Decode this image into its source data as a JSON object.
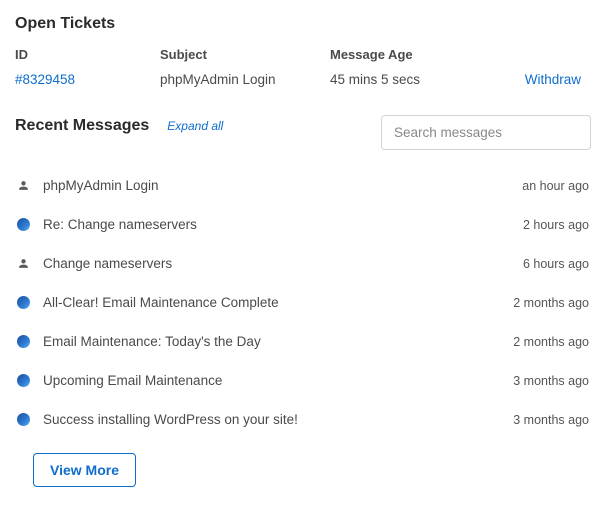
{
  "open_tickets": {
    "title": "Open Tickets",
    "headers": {
      "id": "ID",
      "subject": "Subject",
      "age": "Message Age"
    },
    "rows": [
      {
        "id": "#8329458",
        "subject": "phpMyAdmin Login",
        "age": "45 mins 5 secs",
        "action": "Withdraw"
      }
    ]
  },
  "recent": {
    "title": "Recent Messages",
    "expand": "Expand all",
    "search_placeholder": "Search messages",
    "view_more": "View More",
    "messages": [
      {
        "icon": "person",
        "subject": "phpMyAdmin Login",
        "age": "an hour ago"
      },
      {
        "icon": "globe",
        "subject": "Re: Change nameservers",
        "age": "2 hours ago"
      },
      {
        "icon": "person",
        "subject": "Change nameservers",
        "age": "6 hours ago"
      },
      {
        "icon": "globe",
        "subject": "All-Clear! Email Maintenance Complete",
        "age": "2 months ago"
      },
      {
        "icon": "globe",
        "subject": "Email Maintenance: Today's the Day",
        "age": "2 months ago"
      },
      {
        "icon": "globe",
        "subject": "Upcoming Email Maintenance",
        "age": "3 months ago"
      },
      {
        "icon": "globe",
        "subject": "Success installing WordPress on your site!",
        "age": "3 months ago"
      }
    ]
  }
}
